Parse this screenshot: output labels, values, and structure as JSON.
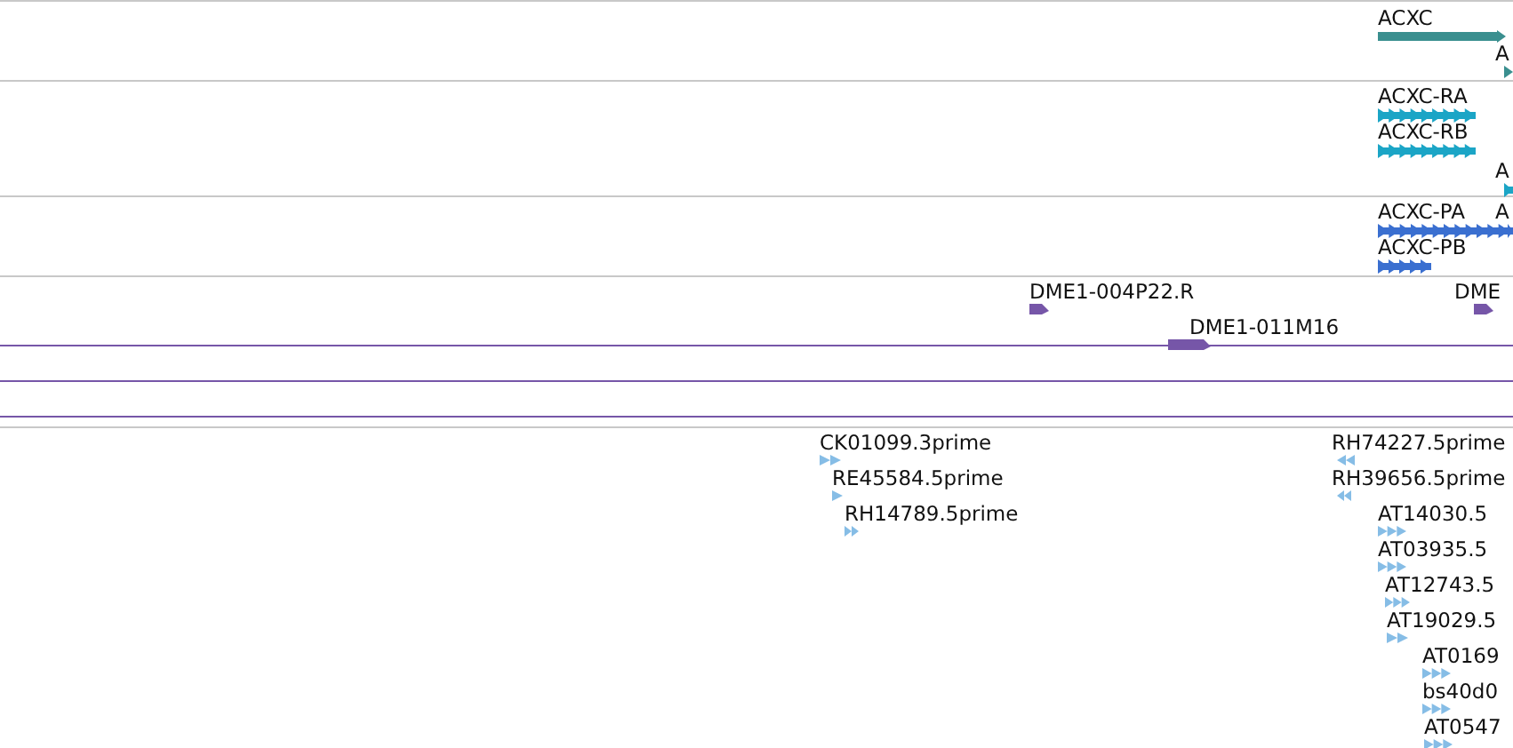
{
  "tracks": [
    {
      "kind": "gene",
      "features": [
        {
          "label": "ACXC",
          "reversed": false
        },
        {
          "label": "A",
          "reversed": false
        }
      ]
    },
    {
      "kind": "transcript",
      "features": [
        {
          "label": "ACXC-RA",
          "reversed": false
        },
        {
          "label": "ACXC-RB",
          "reversed": false
        },
        {
          "label": "A",
          "reversed": false
        }
      ]
    },
    {
      "kind": "protein",
      "features": [
        {
          "label": "ACXC-PA",
          "reversed": false
        },
        {
          "label": "A",
          "reversed": false
        },
        {
          "label": "ACXC-PB",
          "reversed": false
        }
      ]
    },
    {
      "kind": "clone",
      "features": [
        {
          "label": "DME1-004P22.R",
          "reversed": false
        },
        {
          "label": "DME1-011M16",
          "reversed": false
        },
        {
          "label": "DME",
          "reversed": false
        }
      ]
    },
    {
      "kind": "est",
      "features": [
        {
          "label": "CK01099.3prime",
          "reversed": false
        },
        {
          "label": "RE45584.5prime",
          "reversed": false
        },
        {
          "label": "RH14789.5prime",
          "reversed": false
        },
        {
          "label": "RH74227.5prime",
          "reversed": true
        },
        {
          "label": "RH39656.5prime",
          "reversed": true
        },
        {
          "label": "AT14030.5",
          "reversed": false
        },
        {
          "label": "AT03935.5",
          "reversed": false
        },
        {
          "label": "AT12743.5",
          "reversed": false
        },
        {
          "label": "AT19029.5",
          "reversed": false
        },
        {
          "label": "AT0169",
          "reversed": false
        },
        {
          "label": "bs40d0",
          "reversed": false
        },
        {
          "label": "AT0547",
          "reversed": false
        }
      ]
    }
  ]
}
